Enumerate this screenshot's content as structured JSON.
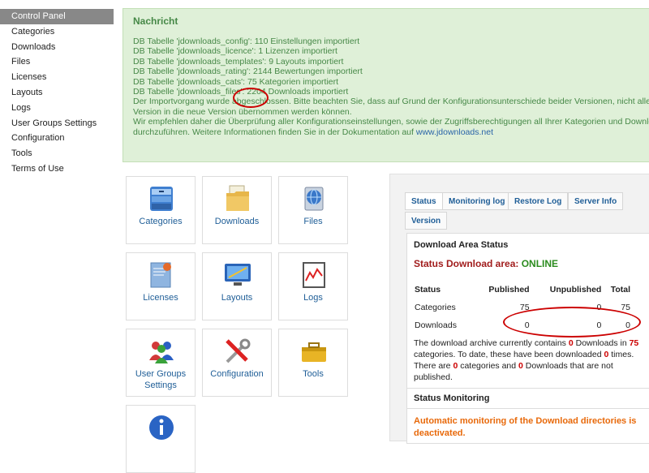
{
  "sidebar": {
    "items": [
      {
        "label": "Control Panel",
        "active": true
      },
      {
        "label": "Categories"
      },
      {
        "label": "Downloads"
      },
      {
        "label": "Files"
      },
      {
        "label": "Licenses"
      },
      {
        "label": "Layouts"
      },
      {
        "label": "Logs"
      },
      {
        "label": "User Groups Settings"
      },
      {
        "label": "Configuration"
      },
      {
        "label": "Tools"
      },
      {
        "label": "Terms of Use"
      }
    ]
  },
  "message": {
    "title": "Nachricht",
    "lines": [
      "DB Tabelle 'jdownloads_config': 110 Einstellungen importiert",
      "DB Tabelle 'jdownloads_licence': 1 Lizenzen importiert",
      "DB Tabelle 'jdownloads_templates': 9 Layouts importiert",
      "DB Tabelle 'jdownloads_rating': 2144 Bewertungen importiert",
      "DB Tabelle 'jdownloads_cats': 75 Kategorien importiert",
      "DB Tabelle 'jdownloads_files': 2204 Downloads importiert",
      "Der Importvorgang wurde abgeschlossen. Bitte beachten Sie, dass auf Grund der Konfigurationsunterschiede beider Versionen, nicht alle Eins",
      "Version in die neue Version übernommen werden können.",
      "Wir empfehlen daher die Überprüfung aller Konfigurationseinstellungen, sowie der Zugriffsberechtigungen all Ihrer Kategorien und Downloads, n",
      "durchzuführen. Weitere Informationen finden Sie in der Dokumentation auf"
    ],
    "link": "www.jdownloads.net"
  },
  "tiles": [
    {
      "label": "Categories",
      "icon": "cabinet-icon"
    },
    {
      "label": "Downloads",
      "icon": "folder-icon"
    },
    {
      "label": "Files",
      "icon": "globe-icon"
    },
    {
      "label": "Licenses",
      "icon": "certificate-icon"
    },
    {
      "label": "Layouts",
      "icon": "monitor-icon"
    },
    {
      "label": "Logs",
      "icon": "chart-icon"
    },
    {
      "label": "User Groups Settings",
      "icon": "users-icon"
    },
    {
      "label": "Configuration",
      "icon": "tools-icon"
    },
    {
      "label": "Tools",
      "icon": "toolbox-icon"
    },
    {
      "label": "",
      "icon": "info-icon"
    }
  ],
  "tabs": [
    "Status",
    "Monitoring log",
    "Restore Log",
    "Server Info",
    "Version"
  ],
  "status": {
    "section_title": "Download Area Status",
    "status_prefix": "Status Download area: ",
    "status_value": "ONLINE",
    "table_headers": [
      "Status",
      "Published",
      "Unpublished",
      "Total"
    ],
    "rows": [
      {
        "name": "Categories",
        "published": "75",
        "unpublished": "0",
        "total": "75"
      },
      {
        "name": "Downloads",
        "published": "0",
        "unpublished": "0",
        "total": "0"
      }
    ],
    "para_a": "The download archive currently contains ",
    "para_b": "0",
    "para_c": " Downloads in ",
    "para_d": "75",
    "para_e": " categories. To date, these have been downloaded ",
    "para_f": "0",
    "para_g": " times. There are ",
    "para_h": "0",
    "para_i": " categories and ",
    "para_j": "0",
    "para_k": " Downloads that are not published.",
    "monitoring_title": "Status Monitoring",
    "monitoring_text": "Automatic monitoring of the Download directories is deactivated."
  },
  "colors": {
    "online": "#2c8c1f",
    "status_red": "#a11d1d",
    "warning": "#e8690a",
    "link": "#1f5e97"
  }
}
